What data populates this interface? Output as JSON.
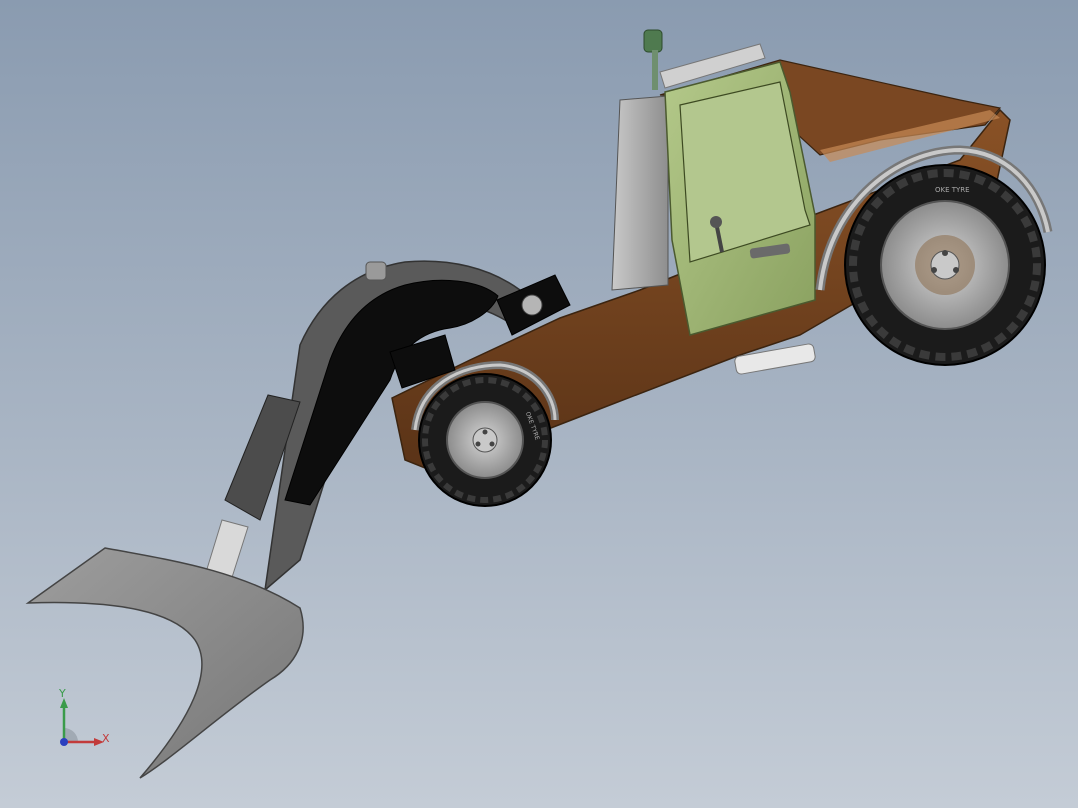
{
  "viewport": {
    "background_top": "#8a9bb0",
    "background_bottom": "#c4ccd6"
  },
  "model": {
    "body_color": "#6b3f1e",
    "cab_color": "#9cb272",
    "arm_color": "#111111",
    "bucket_color": "#8f8f8f",
    "tire_color": "#1b1b1b",
    "rim_color": "#b9b9b9",
    "rear_tire_text": "OKE TYRE",
    "front_tire_text": "OKE TYRE"
  },
  "triad": {
    "y_label": "Y",
    "x_label": "X",
    "y_color": "#3a9b4a",
    "x_color": "#c23b3b",
    "z_color": "#2b3fbf"
  }
}
